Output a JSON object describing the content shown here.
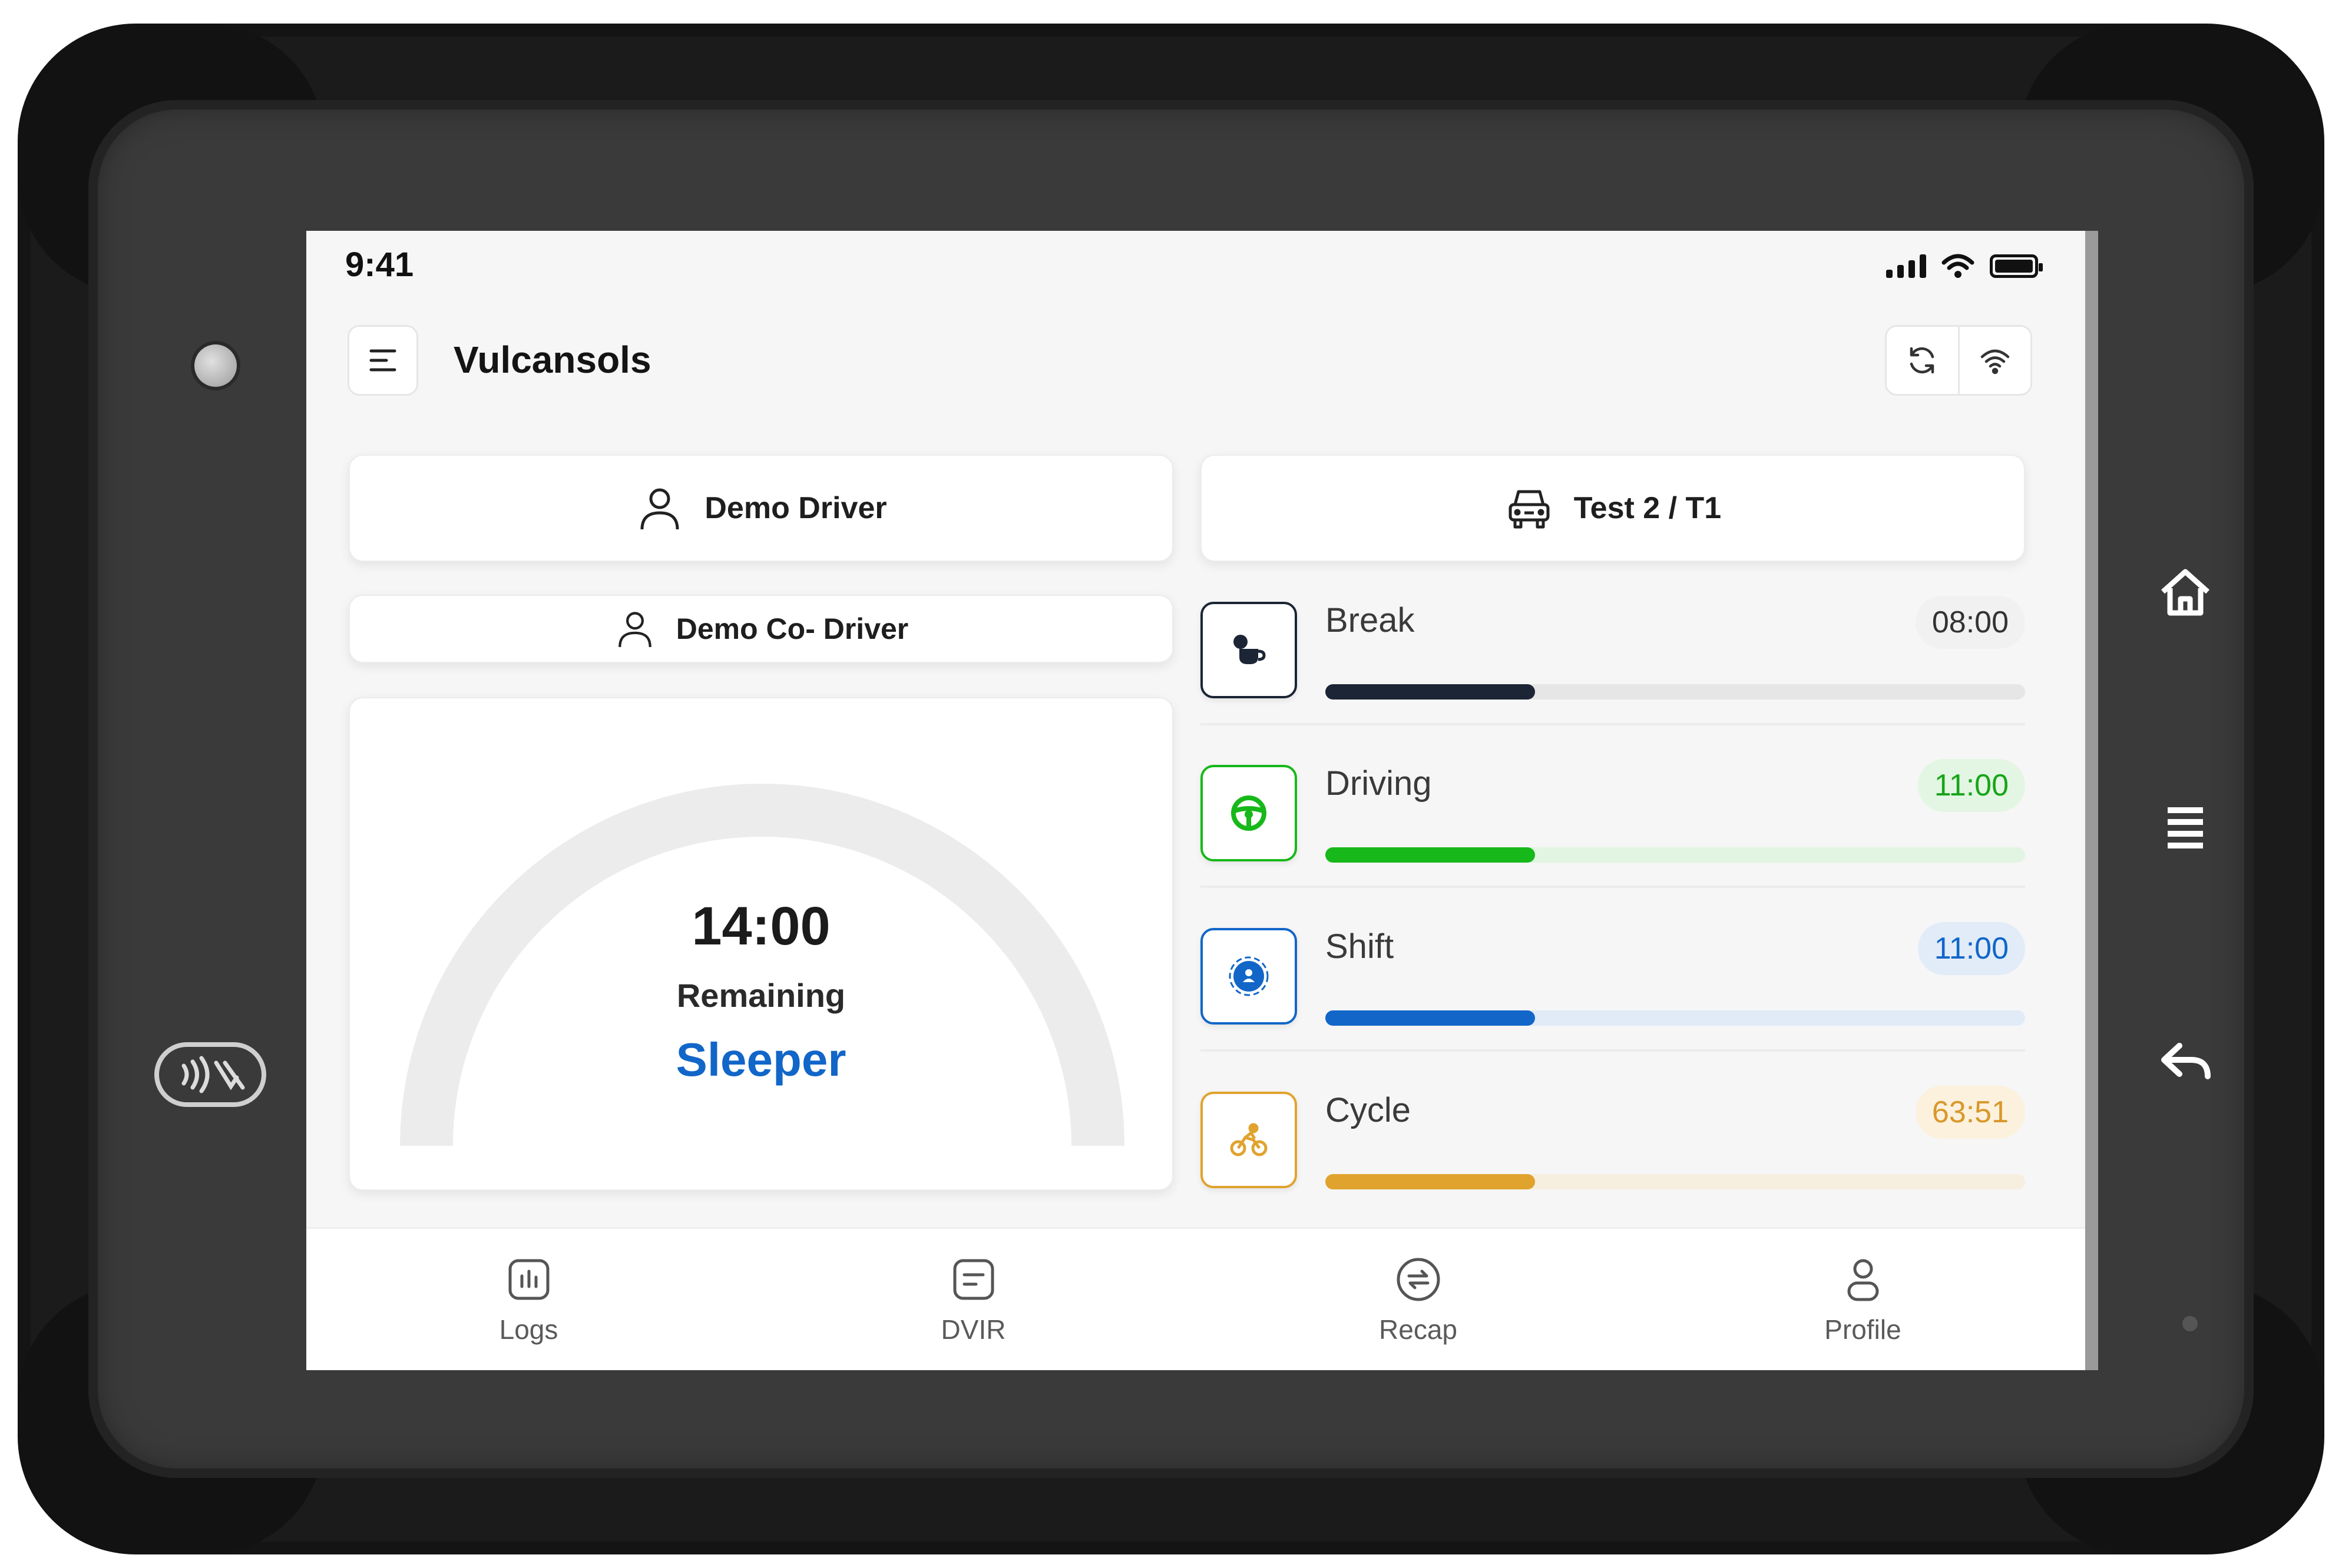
{
  "status_bar": {
    "time": "9:41"
  },
  "app_bar": {
    "title": "Vulcansols",
    "menu_icon": "menu-icon",
    "sync_icon": "sync-icon",
    "wifi_icon": "wifi-icon"
  },
  "driver": {
    "name": "Demo Driver",
    "icon": "user-icon"
  },
  "co_driver": {
    "name": "Demo Co- Driver",
    "icon": "user-icon"
  },
  "vehicle": {
    "name": "Test 2 / T1",
    "icon": "truck-icon"
  },
  "gauge": {
    "time": "14:00",
    "label": "Remaining",
    "status": "Sleeper",
    "status_color": "#1166c8"
  },
  "timers": [
    {
      "label": "Break",
      "value": "08:00",
      "progress": 0.3,
      "color": "#1b2535",
      "track": "#e6e6e6",
      "badge_bg": "#f1f1f1",
      "badge_color": "#333333",
      "icon": "coffee-break-icon"
    },
    {
      "label": "Driving",
      "value": "11:00",
      "progress": 0.3,
      "color": "#17b81a",
      "track": "#e2f5e2",
      "badge_bg": "#e3f6e3",
      "badge_color": "#17a51a",
      "icon": "steering-wheel-icon"
    },
    {
      "label": "Shift",
      "value": "11:00",
      "progress": 0.3,
      "color": "#1166c8",
      "track": "#e1ebf7",
      "badge_bg": "#e1ecf8",
      "badge_color": "#1166c8",
      "icon": "shift-clock-icon"
    },
    {
      "label": "Cycle",
      "value": "63:51",
      "progress": 0.3,
      "color": "#e0a32e",
      "track": "#f6eedf",
      "badge_bg": "#fbf1dd",
      "badge_color": "#d9982a",
      "icon": "cycle-icon"
    }
  ],
  "bottom_nav": [
    {
      "label": "Logs",
      "icon": "logs-icon"
    },
    {
      "label": "DVIR",
      "icon": "dvir-icon"
    },
    {
      "label": "Recap",
      "icon": "recap-icon"
    },
    {
      "label": "Profile",
      "icon": "profile-icon"
    }
  ]
}
